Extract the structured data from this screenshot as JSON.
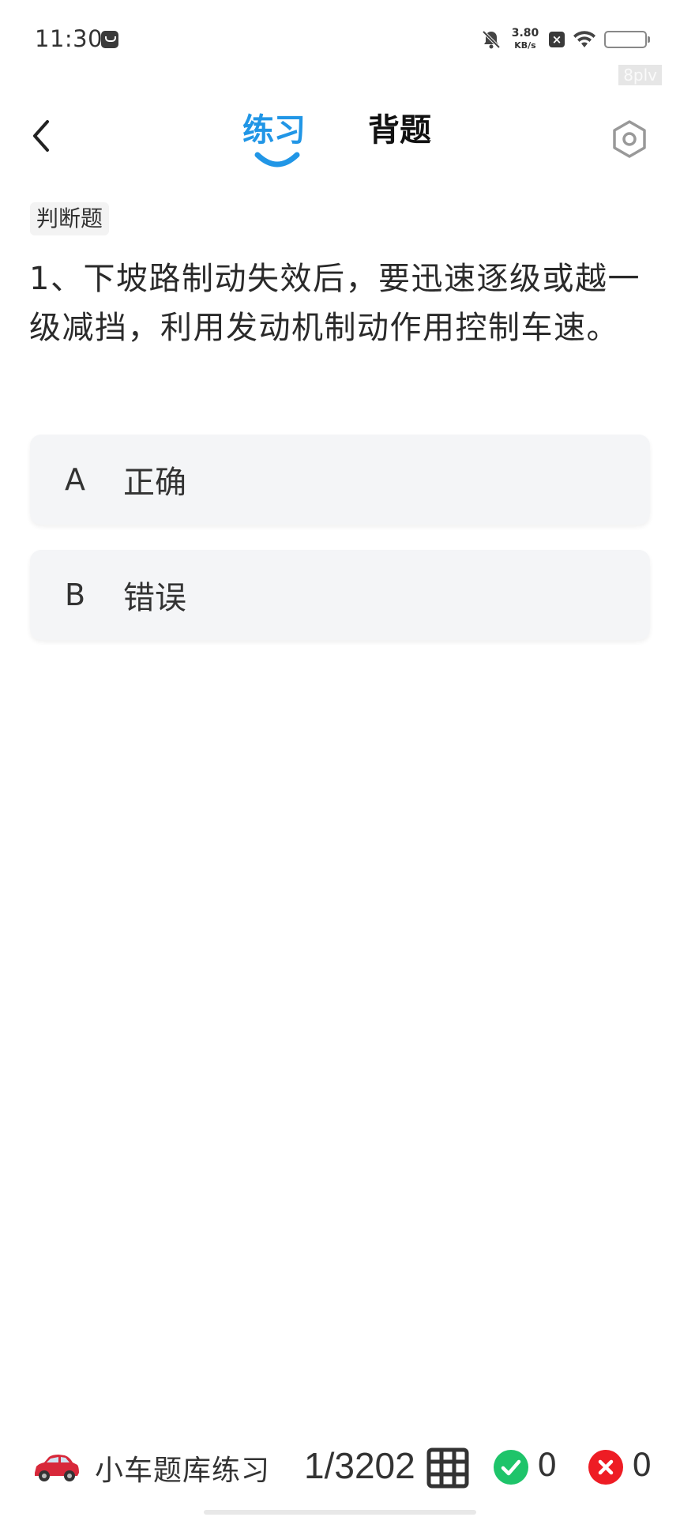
{
  "status_bar": {
    "time": "11:30",
    "net_speed": "3.80",
    "net_unit": "KB/s",
    "battery_level": 1.0,
    "watermark": "8plv"
  },
  "header": {
    "tabs": [
      {
        "label": "练习",
        "active": true
      },
      {
        "label": "背题",
        "active": false
      }
    ],
    "accent_color": "#2196e6"
  },
  "question": {
    "type_badge": "判断题",
    "text": "1、下坡路制动失效后，要迅速逐级或越一级减挡，利用发动机制动作用控制车速。",
    "options": [
      {
        "letter": "A",
        "text": "正确"
      },
      {
        "letter": "B",
        "text": "错误"
      }
    ]
  },
  "bottom_bar": {
    "bank_label": "小车题库练习",
    "progress": "1/3202",
    "correct_count": "0",
    "wrong_count": "0",
    "correct_color": "#1ec46a",
    "wrong_color": "#ee1c24"
  }
}
